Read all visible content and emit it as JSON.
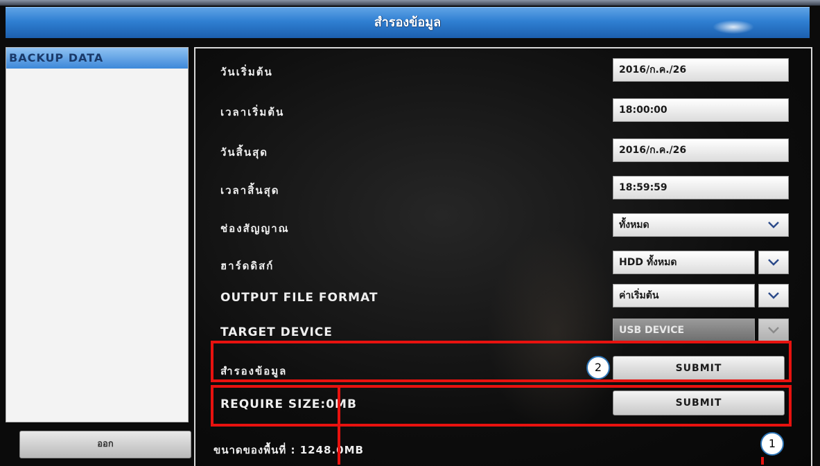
{
  "window": {
    "title": "สำรองข้อมูล"
  },
  "sidebar": {
    "header": "BACKUP DATA",
    "exit_label": "ออก"
  },
  "form": {
    "start_date_label": "วันเริ่มต้น",
    "start_date_value": "2016/ก.ค./26",
    "start_time_label": "เวลาเริ่มต้น",
    "start_time_value": "18:00:00",
    "end_date_label": "วันสิ้นสุด",
    "end_date_value": "2016/ก.ค./26",
    "end_time_label": "เวลาสิ้นสุด",
    "end_time_value": "18:59:59",
    "channel_label": "ช่องสัญญาณ",
    "channel_value": "ทั้งหมด",
    "hdd_label": "ฮาร์ดดิสก์",
    "hdd_value": "HDD ทั้งหมด",
    "format_label": "OUTPUT FILE FORMAT",
    "format_value": "ค่าเริ่มต้น",
    "device_label": "TARGET DEVICE",
    "device_value": "USB DEVICE",
    "backup_label": "สำรองข้อมูล",
    "backup_submit": "SUBMIT",
    "size_label": "REQUIRE SIZE:0MB",
    "size_submit": "SUBMIT",
    "storage_label": "ขนาดของพื้นที่ : 1248.0MB"
  },
  "annotations": {
    "badge_1": "1",
    "badge_2": "2",
    "highlight_color": "#e8120f"
  }
}
